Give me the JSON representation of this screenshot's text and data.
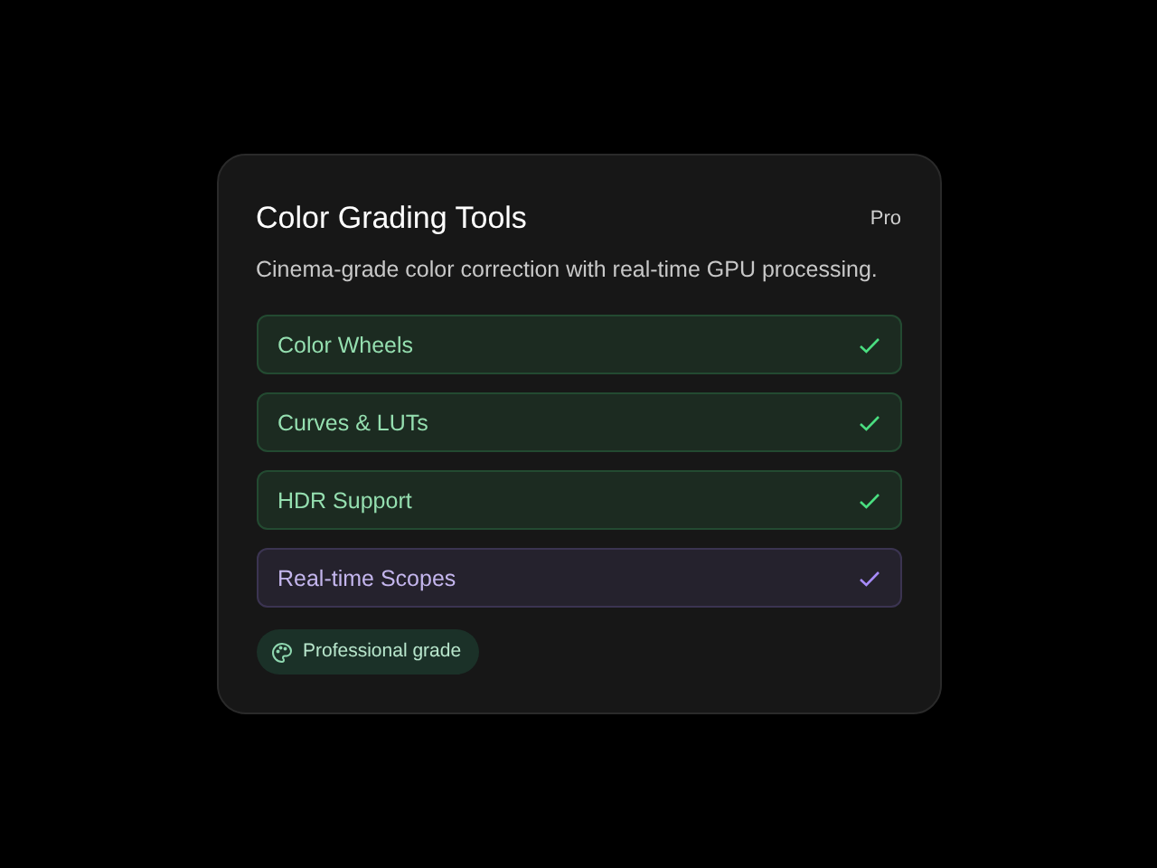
{
  "card": {
    "title": "Color Grading Tools",
    "tier": "Pro",
    "description": "Cinema-grade color correction with real-time GPU processing.",
    "features": [
      {
        "label": "Color Wheels",
        "checked": true,
        "color": "#4ade80"
      },
      {
        "label": "Curves & LUTs",
        "checked": true,
        "color": "#4ade80"
      },
      {
        "label": "HDR Support",
        "checked": true,
        "color": "#4ade80"
      },
      {
        "label": "Real-time Scopes",
        "checked": true,
        "color": "#a78bfa"
      }
    ],
    "badge": {
      "label": "Professional grade"
    }
  }
}
